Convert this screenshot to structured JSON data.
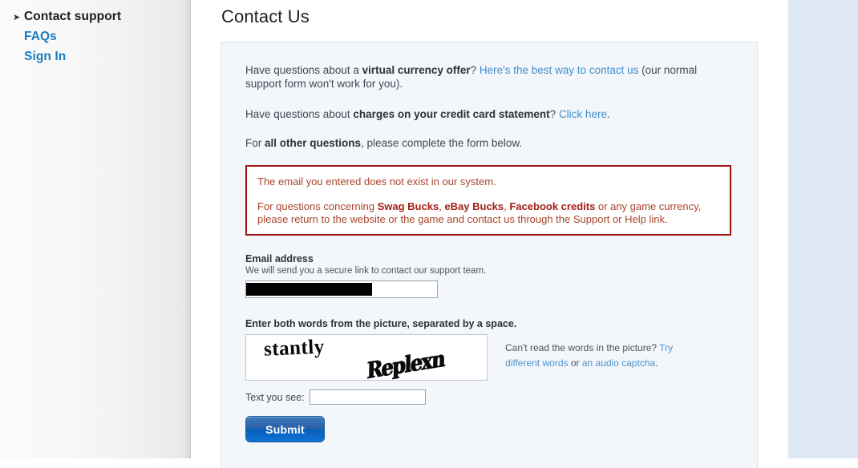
{
  "sidebar": {
    "items": [
      {
        "label": "Contact support",
        "type": "current",
        "icon": "chevron-right-icon"
      },
      {
        "label": "FAQs",
        "type": "link"
      },
      {
        "label": "Sign In",
        "type": "link"
      }
    ],
    "ghost_rows": [
      "",
      "",
      "",
      "",
      "",
      "",
      "",
      "",
      "",
      "",
      "",
      "",
      "",
      "",
      "",
      "",
      ""
    ]
  },
  "page": {
    "title": "Contact Us"
  },
  "intro": {
    "p1_a": "Have questions about a ",
    "p1_b": "virtual currency offer",
    "p1_c": "? ",
    "p1_link": "Here's the best way to contact us",
    "p1_d": " (our normal support form won't work for you).",
    "p2_a": "Have questions about ",
    "p2_b": "charges on your credit card statement",
    "p2_c": "? ",
    "p2_link": "Click here",
    "p2_d": ".",
    "p3_a": "For ",
    "p3_b": "all other questions",
    "p3_c": ", please complete the form below."
  },
  "error": {
    "line1": "The email you entered does not exist in our system.",
    "line2_a": "For questions concerning ",
    "line2_b1": "Swag Bucks",
    "line2_sep1": ", ",
    "line2_b2": "eBay Bucks",
    "line2_sep2": ", ",
    "line2_b3": "Facebook credits",
    "line2_c": " or any game currency, please return to the website or the game and contact us through the Support or Help link.",
    "border_color": "#9e1512",
    "text_color": "#a8442a"
  },
  "form": {
    "email_label": "Email address",
    "email_help": "We will send you a secure link to contact our support team.",
    "email_value": "",
    "email_placeholder": "",
    "email_redacted": true,
    "captcha_label": "Enter both words from the picture, separated by a space.",
    "captcha_word1": "stantly",
    "captcha_word2": "Replexn",
    "captcha_help_a": "Can't read the words in the picture? ",
    "captcha_help_link1": "Try different words",
    "captcha_help_or": " or ",
    "captcha_help_link2": "an audio captcha",
    "captcha_help_end": ".",
    "answer_label": "Text you see:",
    "answer_value": "",
    "answer_placeholder": "",
    "submit_label": "Submit"
  },
  "colors": {
    "link_blue": "#3f8fcf",
    "nav_blue": "#1a7cc1",
    "card_bg": "#f3f6fa",
    "rail_bg": "#dde8f2",
    "submit_blue": "#0f72d6"
  }
}
